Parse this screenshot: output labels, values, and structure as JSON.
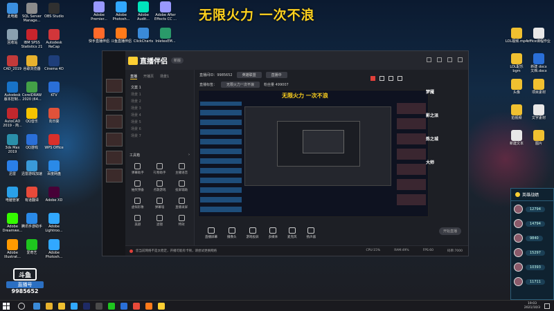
{
  "overlay_title": "无限火力 一次不浪",
  "desktop_icons_left": [
    {
      "label": "此电脑",
      "color": "#3b8fe0"
    },
    {
      "label": "SQL Server\nManage...",
      "color": "#8b8b8b"
    },
    {
      "label": "OBS Studio",
      "color": "#303030"
    },
    {
      "label": "回收站",
      "color": "#8aa0b0"
    },
    {
      "label": "IBM SPSS\nStatistics 21",
      "color": "#c8242c"
    },
    {
      "label": "Autodesk\nReCap",
      "color": "#d2363a"
    },
    {
      "label": "CAD_2019",
      "color": "#c23a3a"
    },
    {
      "label": "谷歌浏览器",
      "color": "#e8b22d"
    },
    {
      "label": "Cinema 4D",
      "color": "#1e3e7a"
    },
    {
      "label": "Autodesk\n版本控制...",
      "color": "#1873c8"
    },
    {
      "label": "CorelDRAW\n2020 (64...",
      "color": "#43a047"
    },
    {
      "label": "KTV",
      "color": "#2a6fd8"
    },
    {
      "label": "AutoCAD\n2019 - 简...",
      "color": "#c2272d"
    },
    {
      "label": "QQ音乐",
      "color": "#f5c400"
    },
    {
      "label": "向日葵",
      "color": "#e0523a"
    },
    {
      "label": "3ds Max\n2019",
      "color": "#2a8faa"
    },
    {
      "label": "QQ游戏",
      "color": "#2a6fd8"
    },
    {
      "label": "WPS Office",
      "color": "#d8302b"
    },
    {
      "label": "迅雷",
      "color": "#2a7fe8"
    },
    {
      "label": "迅雷游戏加速",
      "color": "#3a9ad8"
    },
    {
      "label": "百度网盘",
      "color": "#2a8ae8"
    },
    {
      "label": "电脑管家",
      "color": "#2aa0e8"
    },
    {
      "label": "有道翻译",
      "color": "#e84a3a"
    },
    {
      "label": "Adobe XD",
      "color": "#470137"
    },
    {
      "label": "Adobe\nDreamwe...",
      "color": "#35fa00"
    },
    {
      "label": "腾讯手游助手",
      "color": "#2a8ae8"
    },
    {
      "label": "Adobe\nLightroo...",
      "color": "#31a8ff"
    },
    {
      "label": "Adobe\nIllustrat...",
      "color": "#ff9a00"
    },
    {
      "label": "爱奇艺",
      "color": "#1ec51e"
    },
    {
      "label": "Adobe\nPhotosh...",
      "color": "#31a8ff"
    }
  ],
  "desktop_icons_top": [
    {
      "label": "Adobe\nPremier...",
      "color": "#9999ff"
    },
    {
      "label": "Adobe\nPhotosh...",
      "color": "#31a8ff"
    },
    {
      "label": "Adobe\nAudit...",
      "color": "#00e4bb"
    },
    {
      "label": "Adobe After\nEffects CC ...",
      "color": "#9999ff"
    },
    {
      "label": "快手直播伴侣",
      "color": "#ff6a2a"
    },
    {
      "label": "斗鱼直播伴侣",
      "color": "#ff7a1a"
    },
    {
      "label": "ClickCharts",
      "color": "#3a8ad8"
    },
    {
      "label": "InletexEM...",
      "color": "#2a9a6a"
    }
  ],
  "desktop_icons_right": [
    {
      "label": "LOL视频.mp4",
      "color": "#f0c030"
    },
    {
      "label": "office课程作业",
      "color": "#e8e8e8"
    },
    {
      "label": "LOL配乐\nbgm",
      "color": "#f0c030"
    },
    {
      "label": "新建 docx\n文档.docx",
      "color": "#2a6fd8"
    },
    {
      "label": "头像",
      "color": "#f0c030"
    },
    {
      "label": "项目素材",
      "color": "#f0c030"
    },
    {
      "label": "拍视频",
      "color": "#f0c030"
    },
    {
      "label": "文字素材",
      "color": "#e8e8e8"
    },
    {
      "label": "新建文本",
      "color": "#e8e8e8"
    },
    {
      "label": "图片",
      "color": "#f0c030"
    }
  ],
  "app_window": {
    "app_name": "直播伴侣",
    "version": "新版",
    "sidebar_tabs": [
      "直播",
      "开播页",
      "场景1"
    ],
    "scene_items": [
      "文案 1",
      "场景 1",
      "场景 2",
      "场景 3",
      "场景 4",
      "场景 5",
      "场景 6",
      "场景 7"
    ],
    "tools_header": "工具箱",
    "tools": [
      "弹幕助手",
      "礼物助手",
      "主播语音",
      "抽奖预备",
      "点歌游戏",
      "投屏辅助",
      "虚拟形象",
      "弹幕墙",
      "直播录屏",
      "美颜",
      "滤镜",
      "特效"
    ],
    "room_info": "直播间ID：9985652",
    "room_tag": "英雄联盟",
    "room_status": "直播中",
    "room_label2": "直播标签：",
    "room_desc": "无限火力一次不浪",
    "fans_count": "粉丝量 499007",
    "room_id": "9985652",
    "preview_title": "无限火力 一次不浪",
    "bottom_tools": [
      "直播屏幕",
      "摄像头",
      "游戏投屏",
      "多媒体",
      "麦克风",
      "扬声器"
    ],
    "go_live": "开始直播",
    "status_msg": "您当前网络不是太稳定，开播可能有卡顿，请尝试更换网络",
    "status_metrics": [
      "CPU:15%",
      "RAM:49%",
      "FPS:60",
      "码率:7000"
    ]
  },
  "rank_panel": {
    "header": "英雄战绩",
    "entries": [
      "12794",
      "14794",
      "9840",
      "15297",
      "10393",
      "11711"
    ]
  },
  "side_labels": [
    "梦魇",
    "影之派",
    "炼之城",
    "大师"
  ],
  "watermark": {
    "logo": "斗鱼",
    "name": "直播号",
    "id": "9985652"
  },
  "taskbar": {
    "time": "19:03",
    "date": "2021/10/3"
  }
}
